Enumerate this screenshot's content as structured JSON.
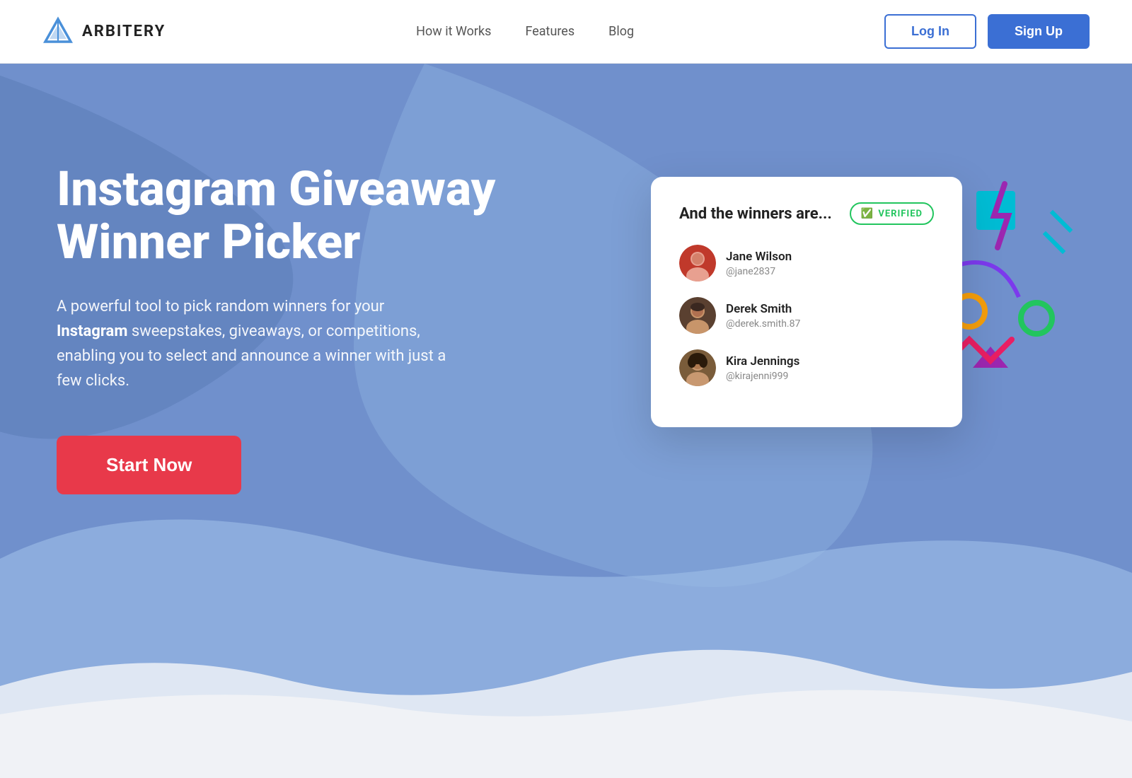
{
  "brand": {
    "name": "ARBITERY",
    "logo_alt": "Arbitery Logo"
  },
  "nav": {
    "links": [
      {
        "label": "How it Works",
        "id": "how-it-works"
      },
      {
        "label": "Features",
        "id": "features"
      },
      {
        "label": "Blog",
        "id": "blog"
      }
    ],
    "login_label": "Log In",
    "signup_label": "Sign Up"
  },
  "hero": {
    "title": "Instagram Giveaway Winner Picker",
    "description_prefix": "A powerful tool to pick random winners for your ",
    "description_bold": "Instagram",
    "description_suffix": " sweepstakes, giveaways, or competitions, enabling you to select and announce a winner with just a few clicks.",
    "cta_label": "Start Now"
  },
  "winners_card": {
    "title": "And the winners are...",
    "verified_label": "VERIFIED",
    "winners": [
      {
        "name": "Jane Wilson",
        "handle": "@jane2837",
        "color": "#c0392b"
      },
      {
        "name": "Derek Smith",
        "handle": "@derek.smith.87",
        "color": "#4a3728"
      },
      {
        "name": "Kira Jennings",
        "handle": "@kirajenni999",
        "color": "#7a5c3a"
      }
    ]
  },
  "colors": {
    "hero_bg": "#7090cc",
    "hero_blob1": "#7aa0d8",
    "hero_blob2": "#8fb5e0",
    "cta_bg": "#e8394a",
    "login_color": "#3b6fd4",
    "signup_bg": "#3b6fd4",
    "verified_color": "#22c55e"
  }
}
